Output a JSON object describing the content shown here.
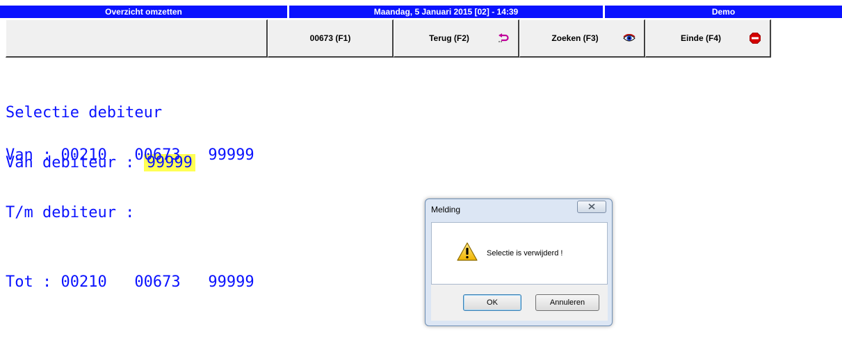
{
  "header": {
    "left": "Overzicht omzetten",
    "center": "Maandag, 5 Januari 2015 [02] - 14:39",
    "right": "Demo"
  },
  "toolbar": {
    "buttons": [
      {
        "label": "00673    (F1)",
        "icon": ""
      },
      {
        "label": "Terug (F2)",
        "icon": "return-arrow-icon"
      },
      {
        "label": "Zoeken (F3)",
        "icon": "eye-icon"
      },
      {
        "label": "Einde (F4)",
        "icon": "stop-icon"
      }
    ]
  },
  "screen": {
    "heading": "Selectie debiteur",
    "van_label": "Van debiteur : ",
    "van_value": "99999",
    "tm_label": "T/m debiteur :",
    "van_line": "Van : 00210   00673   99999",
    "tot_line": "Tot : 00210   00673   99999"
  },
  "dialog": {
    "title": "Melding",
    "message": "Selectie is verwijderd !",
    "ok_label": "OK",
    "cancel_label": "Annuleren"
  },
  "colors": {
    "header_blue": "#0a12ff",
    "terminal_text": "#0a12ff",
    "highlight": "#ffff55"
  }
}
